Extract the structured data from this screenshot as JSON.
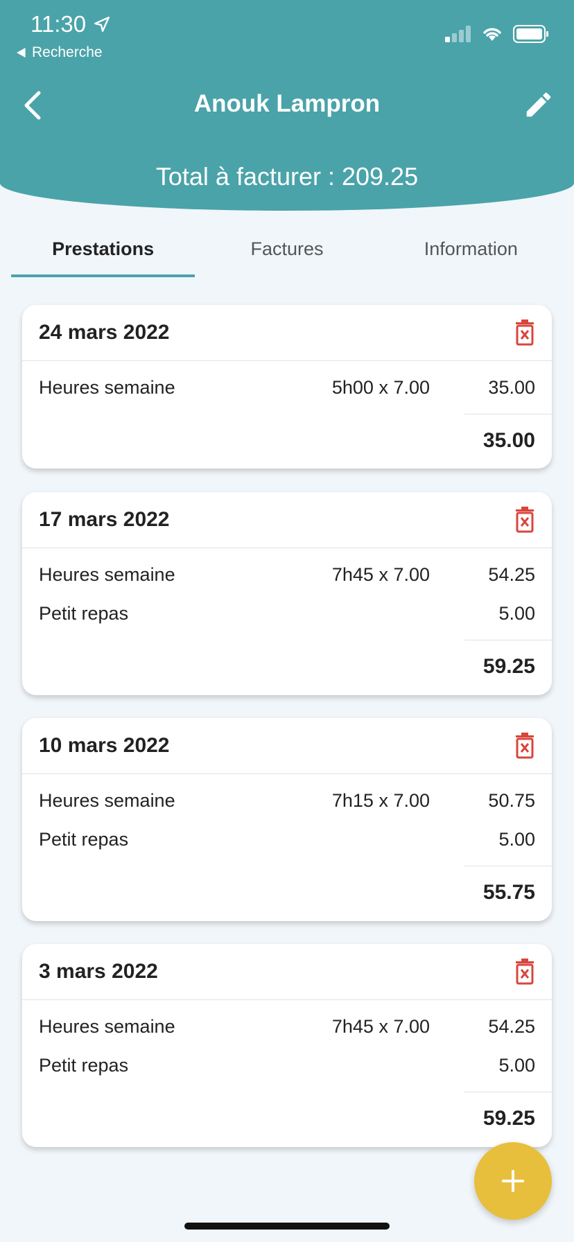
{
  "status_bar": {
    "time": "11:30",
    "back_app_label": "Recherche"
  },
  "header": {
    "title": "Anouk Lampron",
    "total_label": "Total à facturer : 209.25"
  },
  "tabs": [
    {
      "label": "Prestations",
      "active": true
    },
    {
      "label": "Factures",
      "active": false
    },
    {
      "label": "Information",
      "active": false
    }
  ],
  "cards": [
    {
      "date": "24 mars 2022",
      "rows": [
        {
          "label": "Heures semaine",
          "qty": "5h00 x 7.00",
          "amount": "35.00"
        }
      ],
      "total": "35.00"
    },
    {
      "date": "17 mars 2022",
      "rows": [
        {
          "label": "Heures semaine",
          "qty": "7h45 x 7.00",
          "amount": "54.25"
        },
        {
          "label": "Petit repas",
          "qty": "",
          "amount": "5.00"
        }
      ],
      "total": "59.25"
    },
    {
      "date": "10 mars 2022",
      "rows": [
        {
          "label": "Heures semaine",
          "qty": "7h15 x 7.00",
          "amount": "50.75"
        },
        {
          "label": "Petit repas",
          "qty": "",
          "amount": "5.00"
        }
      ],
      "total": "55.75"
    },
    {
      "date": "3 mars 2022",
      "rows": [
        {
          "label": "Heures semaine",
          "qty": "7h45 x 7.00",
          "amount": "54.25"
        },
        {
          "label": "Petit repas",
          "qty": "",
          "amount": "5.00"
        }
      ],
      "total": "59.25"
    }
  ],
  "colors": {
    "primary": "#4aa3a9",
    "delete": "#d9453c",
    "fab": "#e8bf3c"
  },
  "icons": {
    "nav_back": "chevron-left-icon",
    "edit": "pencil-icon",
    "delete": "trash-icon",
    "add": "plus-icon"
  }
}
